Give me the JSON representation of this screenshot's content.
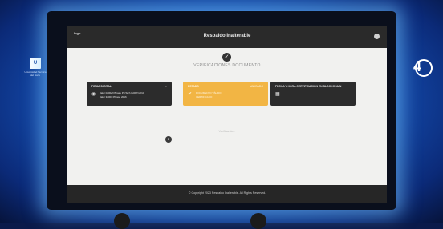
{
  "screen": {
    "brand": "logo",
    "title": "Respaldo Inalterable",
    "subtitle": "VERIFICACIONES DOCUMENTO",
    "cards": [
      {
        "label": "FIRMA DIGITAL",
        "lines": [
          "Valor 0x00ef Phrase PinTech 0x0b7Cef10",
          "Valor 3x001 Phrase 2016"
        ],
        "icon": "fingerprint-icon"
      },
      {
        "label": "ESTADO",
        "side": "VALIDADO",
        "lines": [
          "DOCUMENTO VÁLIDO",
          "CERTIFICADO"
        ],
        "icon": "check-icon"
      },
      {
        "label": "FECHA Y HORA CERTIFICACIÓN EN BLOCKCHAIN",
        "lines": [],
        "icon": "calendar-icon"
      }
    ],
    "loading": "Verificando...",
    "footer": "© Copyright 2023 Respaldo Inalterable. All Rights Reserved."
  },
  "colors": {
    "accent": "#f2b544",
    "dark_card": "#2c2c2c",
    "stage_blue": "#1653b8"
  },
  "side_logos": {
    "left_text": "Universidad Técnica del Norte"
  }
}
